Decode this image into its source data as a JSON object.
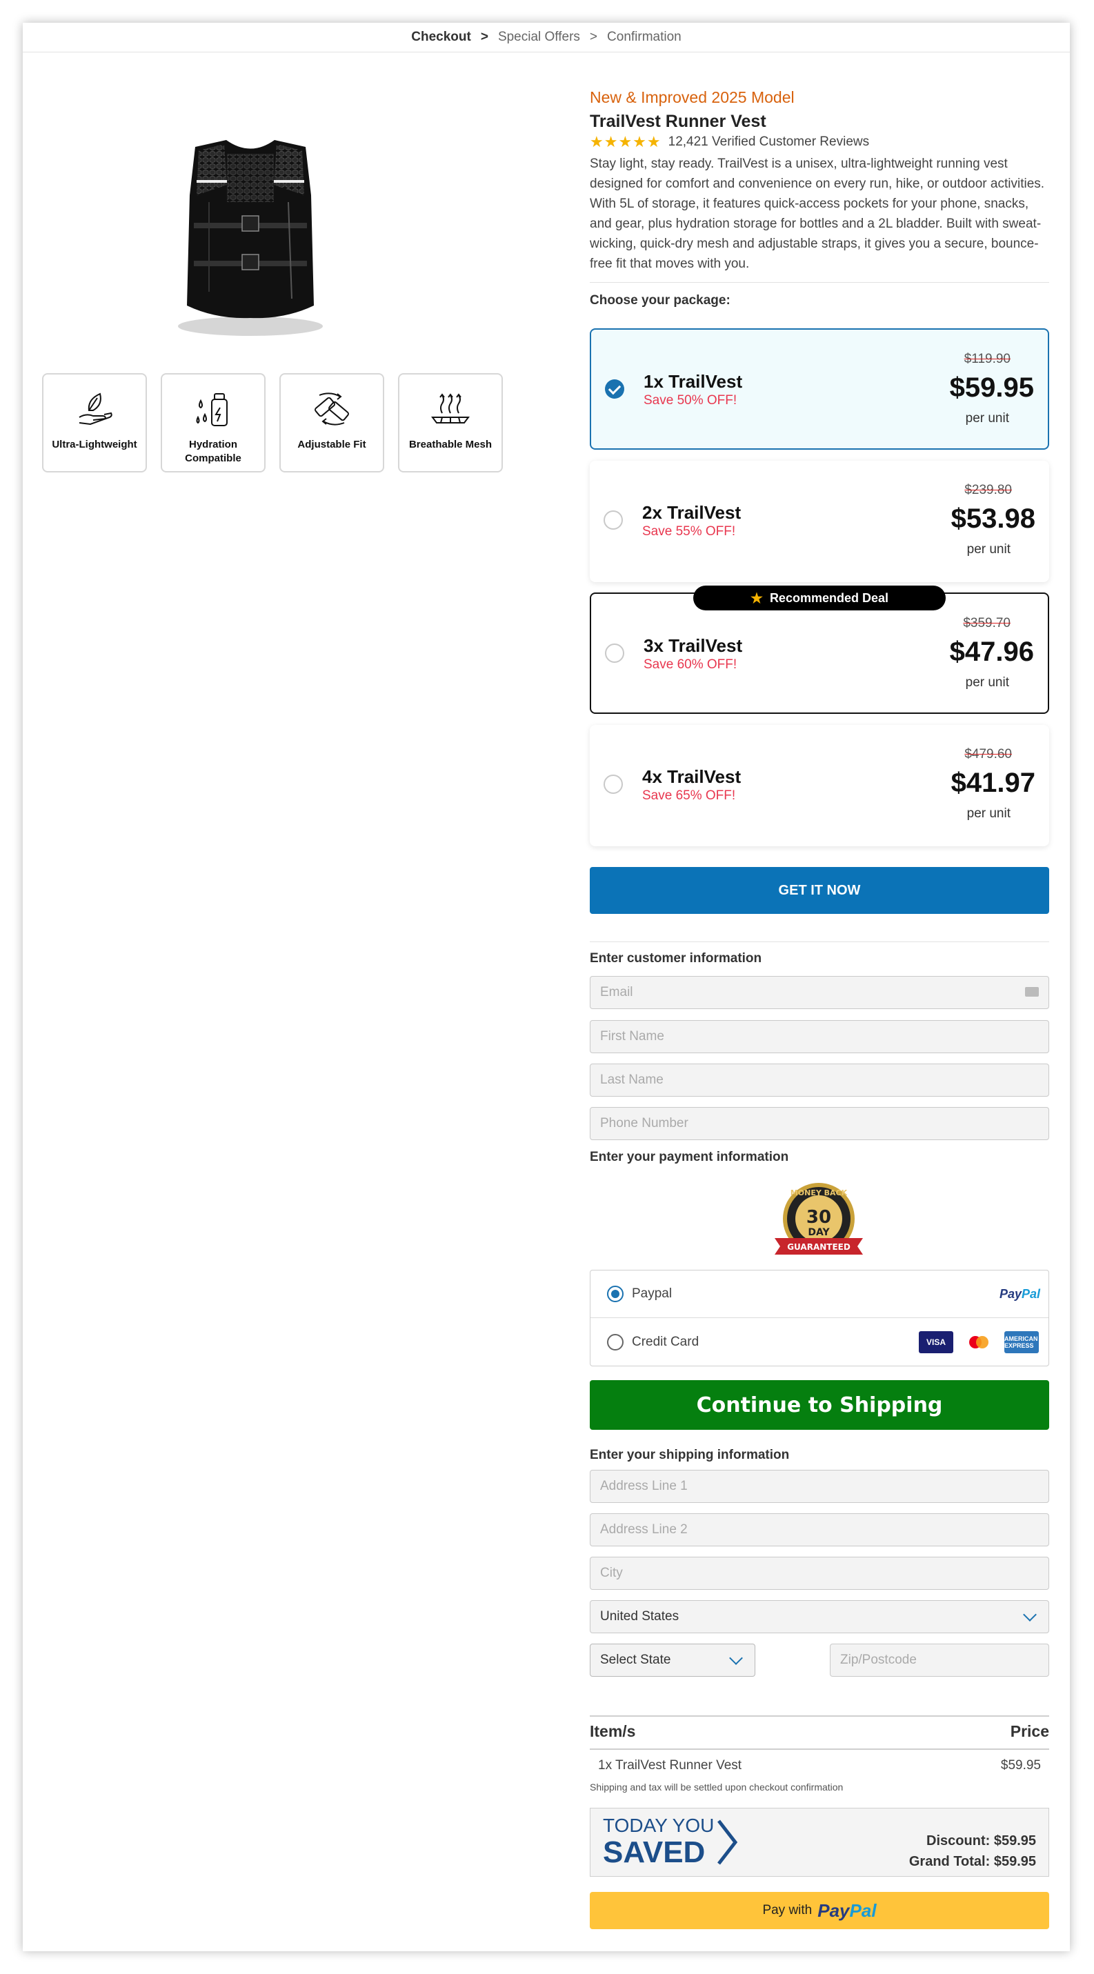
{
  "breadcrumb": {
    "step1": "Checkout",
    "step2": "Special Offers",
    "step3": "Confirmation",
    "sep": ">"
  },
  "features": [
    {
      "label": "Ultra-Lightweight",
      "icon": "hand-feather-icon"
    },
    {
      "label": "Hydration Compatible",
      "icon": "water-bottle-icon"
    },
    {
      "label": "Adjustable Fit",
      "icon": "adjust-straps-icon"
    },
    {
      "label": "Breathable Mesh",
      "icon": "breathable-mesh-icon"
    }
  ],
  "product": {
    "tag": "New & Improved 2025 Model",
    "title": "TrailVest Runner Vest",
    "stars": "★★★★★",
    "reviews": "12,421 Verified Customer Reviews",
    "description": "Stay light, stay ready. TrailVest is a unisex, ultra-lightweight running vest designed for comfort and convenience on every run, hike, or outdoor activities. With 5L of storage, it features quick-access pockets for your phone, snacks, and gear, plus hydration storage for bottles and a 2L bladder. Built with sweat-wicking, quick-dry mesh and adjustable straps, it gives you a secure, bounce-free fit that moves with you."
  },
  "choose_label": "Choose your package:",
  "packages": [
    {
      "name": "1x TrailVest",
      "save": "Save 50% OFF!",
      "old": "$119.90",
      "price": "$59.95",
      "per": "per unit",
      "selected": true
    },
    {
      "name": "2x TrailVest",
      "save": "Save 55% OFF!",
      "old": "$239.80",
      "price": "$53.98",
      "per": "per unit",
      "selected": false
    },
    {
      "name": "3x TrailVest",
      "save": "Save 60% OFF!",
      "old": "$359.70",
      "price": "$47.96",
      "per": "per unit",
      "selected": false,
      "badge": "Recommended Deal"
    },
    {
      "name": "4x TrailVest",
      "save": "Save 65% OFF!",
      "old": "$479.60",
      "price": "$41.97",
      "per": "per unit",
      "selected": false
    }
  ],
  "get_it_now": "GET IT NOW",
  "customer": {
    "heading": "Enter customer information",
    "email": "Email",
    "first_name": "First Name",
    "last_name": "Last Name",
    "phone": "Phone Number"
  },
  "payment": {
    "heading": "Enter your payment information",
    "badge": {
      "top": "MONEY BACK",
      "num": "30",
      "day": "DAY",
      "ribbon": "GUARANTEED"
    },
    "paypal_label": "Paypal",
    "paypal_logo_a": "Pay",
    "paypal_logo_b": "Pal",
    "card_label": "Credit Card",
    "visa": "VISA",
    "amex": "AMERICAN EXPRESS",
    "selected": "paypal"
  },
  "continue_btn": "Continue to Shipping",
  "shipping": {
    "heading": "Enter your shipping information",
    "address1": "Address Line 1",
    "address2": "Address Line 2",
    "city": "City",
    "country": "United States",
    "state": "Select State",
    "zip": "Zip/Postcode"
  },
  "summary": {
    "col_item": "Item/s",
    "col_price": "Price",
    "item": "1x TrailVest Runner Vest",
    "item_price": "$59.95",
    "note": "Shipping and tax will be settled upon checkout confirmation",
    "today": "TODAY YOU",
    "saved": "SAVED",
    "discount": "Discount: $59.95",
    "grand_total": "Grand Total: $59.95"
  },
  "paypal_btn": {
    "prefix": "Pay with",
    "logo_a": "Pay",
    "logo_b": "Pal"
  },
  "colors": {
    "brand_blue": "#0b73b7",
    "continue_green": "#057f0f",
    "paypal_yellow": "#ffc43a",
    "save_red": "#e8374f",
    "tag_orange": "#d8620d"
  }
}
